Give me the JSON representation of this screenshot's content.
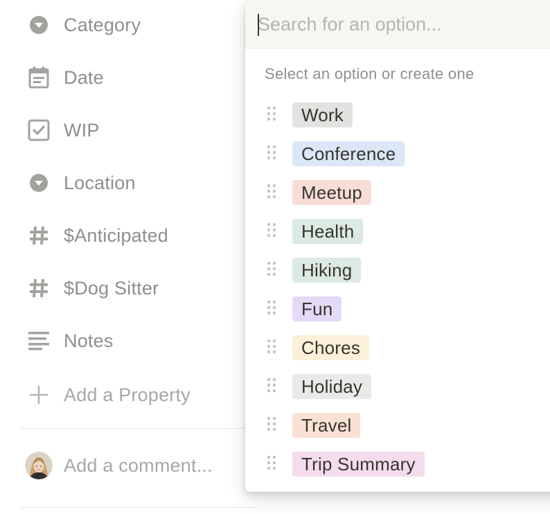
{
  "properties": [
    {
      "label": "Category",
      "icon": "select-caret-icon"
    },
    {
      "label": "Date",
      "icon": "calendar-icon"
    },
    {
      "label": "WIP",
      "icon": "checkbox-icon"
    },
    {
      "label": "Location",
      "icon": "select-caret-icon"
    },
    {
      "label": "$Anticipated",
      "icon": "number-hash-icon"
    },
    {
      "label": "$Dog Sitter",
      "icon": "number-hash-icon"
    },
    {
      "label": "Notes",
      "icon": "text-lines-icon"
    }
  ],
  "add_property": {
    "label": "Add a Property",
    "icon": "plus-icon"
  },
  "comment": {
    "placeholder": "Add a comment...",
    "icon": "avatar"
  },
  "dropdown": {
    "search_placeholder": "Search for an option...",
    "hint": "Select an option or create one",
    "options": [
      {
        "label": "Work",
        "color": "#e3e2e0"
      },
      {
        "label": "Conference",
        "color": "#dbe6f7"
      },
      {
        "label": "Meetup",
        "color": "#f8ddd7"
      },
      {
        "label": "Health",
        "color": "#dde9e3"
      },
      {
        "label": "Hiking",
        "color": "#dde9e3"
      },
      {
        "label": "Fun",
        "color": "#e2daf6"
      },
      {
        "label": "Chores",
        "color": "#fbf0d9"
      },
      {
        "label": "Holiday",
        "color": "#e9e9e8"
      },
      {
        "label": "Travel",
        "color": "#f9e2d3"
      },
      {
        "label": "Trip Summary",
        "color": "#f4dcec"
      }
    ]
  },
  "colors": {
    "icon_gray": "#a3a29e",
    "label_gray": "#8f8e8a",
    "text": "#37352f"
  }
}
